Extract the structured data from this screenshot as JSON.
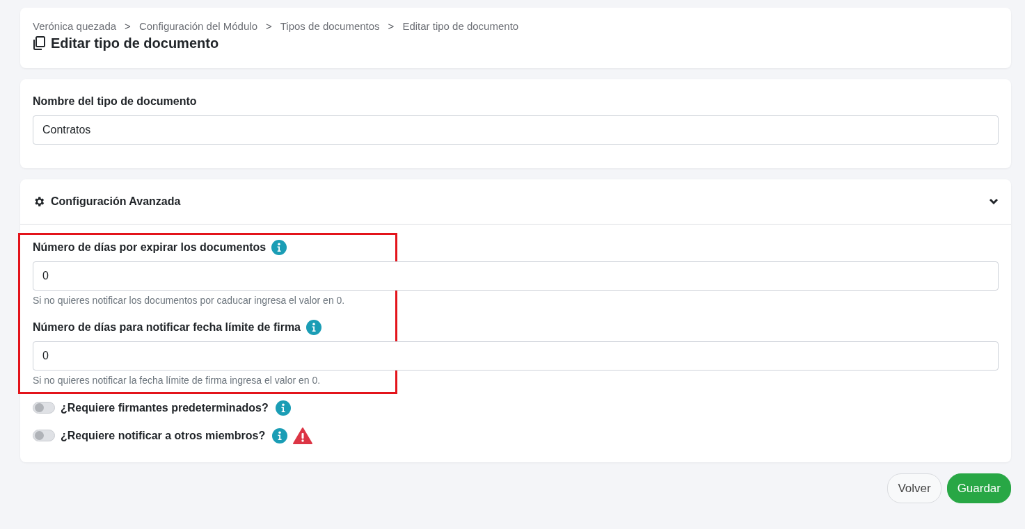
{
  "breadcrumb": [
    {
      "kind": "crumb",
      "text": "Verónica quezada"
    },
    {
      "kind": "separator",
      "text": ">"
    },
    {
      "kind": "crumb",
      "text": "Configuración del Módulo"
    },
    {
      "kind": "separator",
      "text": ">"
    },
    {
      "kind": "crumb",
      "text": "Tipos de documentos"
    },
    {
      "kind": "separator",
      "text": ">"
    },
    {
      "kind": "crumb",
      "text": "Editar tipo de documento"
    }
  ],
  "page_title": "Editar tipo de documento",
  "name_field": {
    "label": "Nombre del tipo de documento",
    "value": "Contratos"
  },
  "advanced": {
    "title": "Configuración Avanzada",
    "expanded": true,
    "highlighted": true,
    "fields": [
      {
        "label": "Número de días por expirar los documentos",
        "value": "0",
        "help": "Si no quieres notificar los documentos por caducar ingresa el valor en 0."
      },
      {
        "label": "Número de días para notificar fecha límite de firma",
        "value": "0",
        "help": "Si no quieres notificar la fecha límite de firma ingresa el valor en 0."
      }
    ],
    "toggles": [
      {
        "label": "¿Requiere firmantes predeterminados?",
        "on": false,
        "warning": false
      },
      {
        "label": "¿Requiere notificar a otros miembros?",
        "on": false,
        "warning": true
      }
    ]
  },
  "buttons": [
    {
      "kind": "secondary",
      "text": "Volver"
    },
    {
      "kind": "primary",
      "text": "Guardar"
    }
  ]
}
